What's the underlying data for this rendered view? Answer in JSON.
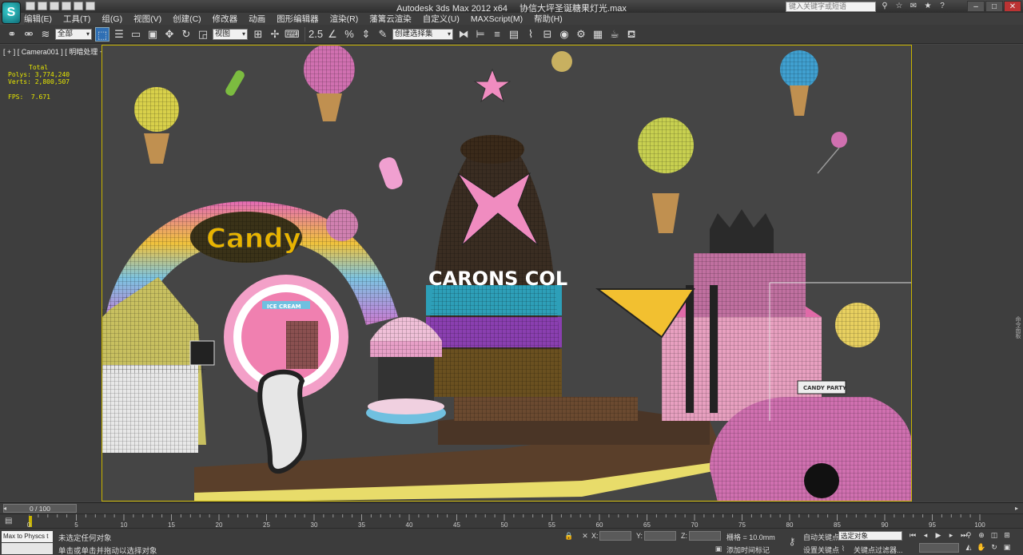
{
  "title": {
    "app": "Autodesk 3ds Max  2012 x64",
    "file": "协信大坪圣诞糖果灯光.max",
    "search_placeholder": "键入关键字或短语"
  },
  "menu": [
    "编辑(E)",
    "工具(T)",
    "组(G)",
    "视图(V)",
    "创建(C)",
    "修改器",
    "动画",
    "图形编辑器",
    "渲染(R)",
    "藩篱云渲染",
    "自定义(U)",
    "MAXScript(M)",
    "帮助(H)"
  ],
  "toolbar": {
    "selection_filter": "全部",
    "reference_coord": "视图",
    "named_selection": "创建选择集"
  },
  "viewport": {
    "label": "[ + ] [ Camera001 ] [ 明暗处理 + 边面 ]",
    "stats": {
      "total_label": "Total",
      "polys_label": "Polys:",
      "polys": "3,774,240",
      "verts_label": "Verts:",
      "verts": "2,800,507",
      "fps_label": "FPS:",
      "fps": "7.671"
    },
    "scene_text_candy": "Candy",
    "scene_text_macarons": "CARONS COL",
    "scene_text_icecream": "ICE CREAM",
    "scene_text_party": "CANDY PARTY"
  },
  "command_panel_tab": "命令面板",
  "time_slider": {
    "frame": "0 / 100"
  },
  "track": {
    "ticks": [
      "0",
      "5",
      "10",
      "15",
      "20",
      "25",
      "30",
      "35",
      "40",
      "45",
      "50",
      "55",
      "60",
      "65",
      "70",
      "75",
      "80",
      "85",
      "90",
      "95",
      "100"
    ]
  },
  "status": {
    "maxscript": "Max to Physcs t",
    "line1": "未选定任何对象",
    "line2": "单击或单击并拖动以选择对象",
    "x_label": "X:",
    "y_label": "Y:",
    "z_label": "Z:",
    "grid": "栅格 = 10.0mm",
    "add_time_tag": "添加时间标记",
    "auto_key": "自动关键点",
    "set_key": "设置关键点",
    "selection_set": "选定对象",
    "key_filters": "关键点过滤器..."
  }
}
